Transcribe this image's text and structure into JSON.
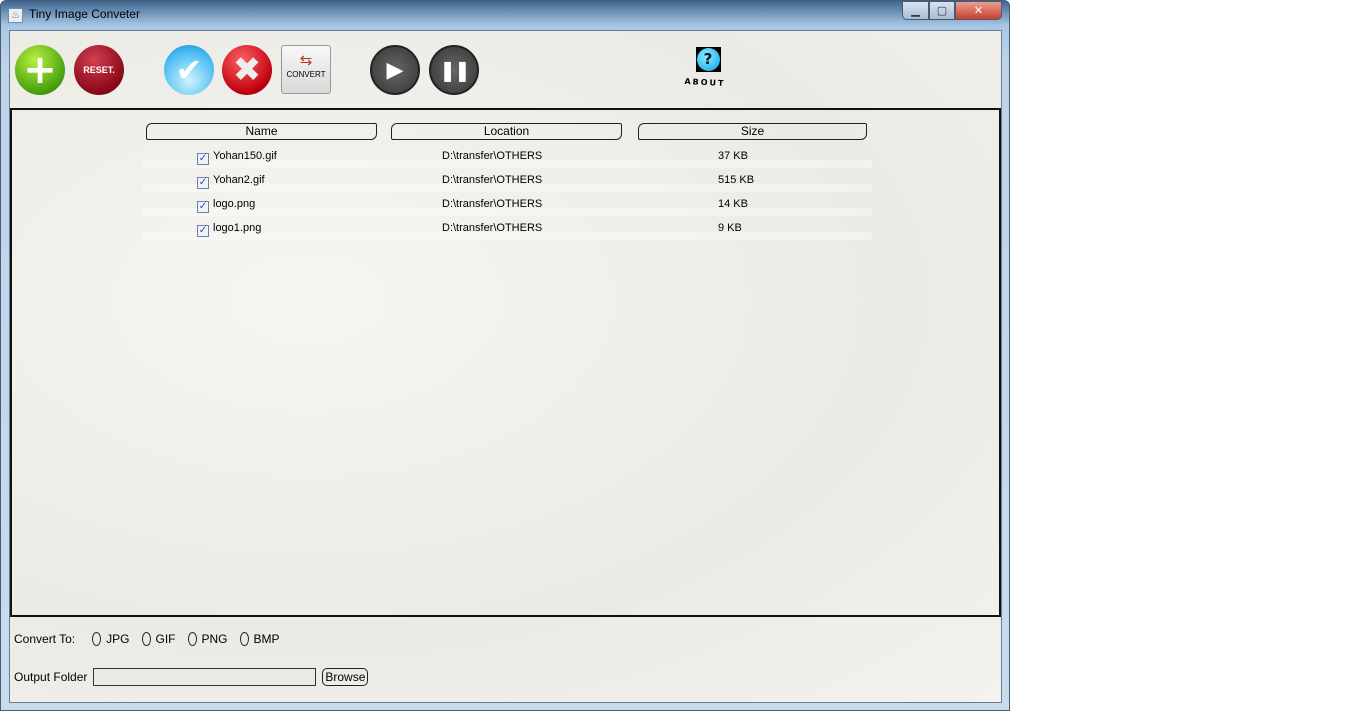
{
  "window": {
    "title": "Tiny Image Conveter",
    "minimize": "▁",
    "maximize": "▢",
    "close": "✕"
  },
  "toolbar": {
    "add_glyph": "+",
    "reset_label": "RESET.",
    "check_glyph": "✔",
    "cancel_glyph": "✖",
    "convert_label": "CONVERT",
    "convert_glyph": "⇆",
    "play_glyph": "▶",
    "pause_glyph": "❚❚",
    "about_glyph": "?",
    "about_label": "ABOUT"
  },
  "table": {
    "columns": [
      "Name",
      "Location",
      "Size"
    ],
    "rows": [
      {
        "checked": true,
        "name": "Yohan150.gif",
        "location": "D:\\transfer\\OTHERS",
        "size": "37 KB"
      },
      {
        "checked": true,
        "name": "Yohan2.gif",
        "location": "D:\\transfer\\OTHERS",
        "size": "515 KB"
      },
      {
        "checked": true,
        "name": "logo.png",
        "location": "D:\\transfer\\OTHERS",
        "size": "14 KB"
      },
      {
        "checked": true,
        "name": "logo1.png",
        "location": "D:\\transfer\\OTHERS",
        "size": "9 KB"
      }
    ]
  },
  "convert_to": {
    "label": "Convert To:",
    "options": [
      "JPG",
      "GIF",
      "PNG",
      "BMP"
    ]
  },
  "output": {
    "label": "Output Folder",
    "value": "",
    "browse_label": "Browse"
  }
}
